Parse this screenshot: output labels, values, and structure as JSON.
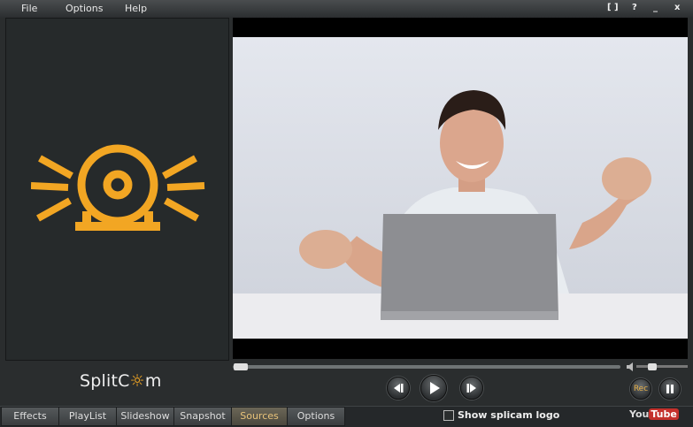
{
  "menu": {
    "file": "File",
    "options": "Options",
    "help": "Help"
  },
  "window_controls": {
    "fullscreen": "[ ]",
    "help": "?",
    "minimize": "_",
    "close": "x"
  },
  "brand": {
    "prefix": "Split",
    "c_letter": "C",
    "suffix": "m"
  },
  "player": {
    "rec_label": "Rec",
    "seek_progress": 0.0
  },
  "tabs": [
    {
      "label": "Effects"
    },
    {
      "label": "PlayList"
    },
    {
      "label": "Slideshow"
    },
    {
      "label": "Snapshot"
    },
    {
      "label": "Sources",
      "active": true
    },
    {
      "label": "Options"
    }
  ],
  "show_logo": {
    "label": "Show splicam logo",
    "checked": false
  },
  "youtube": {
    "you": "You",
    "tube": "Tube"
  },
  "colors": {
    "accent": "#f2a623",
    "active_tab_text": "#e8c37a",
    "background": "#2a2d2e"
  },
  "icons": [
    "webcam-logo-icon",
    "prev-icon",
    "play-icon",
    "next-icon",
    "volume-icon",
    "record-icon",
    "pause-icon"
  ]
}
